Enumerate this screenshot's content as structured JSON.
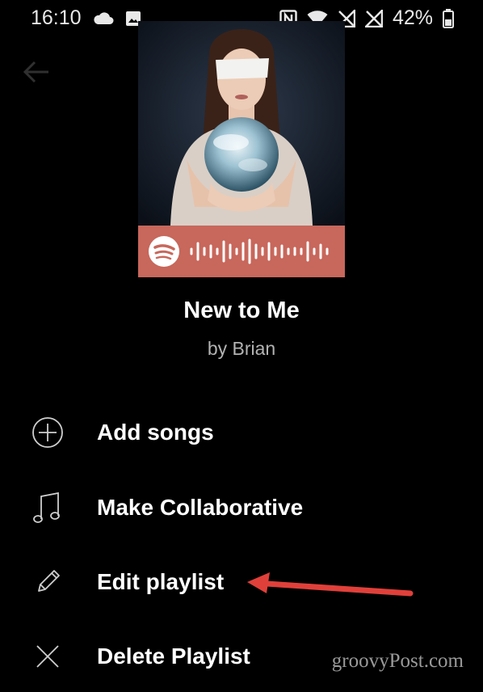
{
  "status_bar": {
    "time": "16:10",
    "battery": "42%",
    "icons_left": [
      "cloud-icon",
      "image-icon"
    ],
    "icons_right": [
      "nfc-icon",
      "wifi-icon",
      "no-signal-icon",
      "no-signal-icon",
      "battery-icon"
    ]
  },
  "playlist": {
    "title": "New to Me",
    "owner": "by Brian",
    "code_color": "#c8675b"
  },
  "menu": {
    "items": [
      {
        "label": "Add songs",
        "icon": "add-circle-icon"
      },
      {
        "label": "Make Collaborative",
        "icon": "music-note-icon"
      },
      {
        "label": "Edit playlist",
        "icon": "pencil-icon"
      },
      {
        "label": "Delete Playlist",
        "icon": "close-icon"
      }
    ]
  },
  "annotation": {
    "arrow_color": "#e0403a"
  },
  "watermark": "groovyPost.com"
}
